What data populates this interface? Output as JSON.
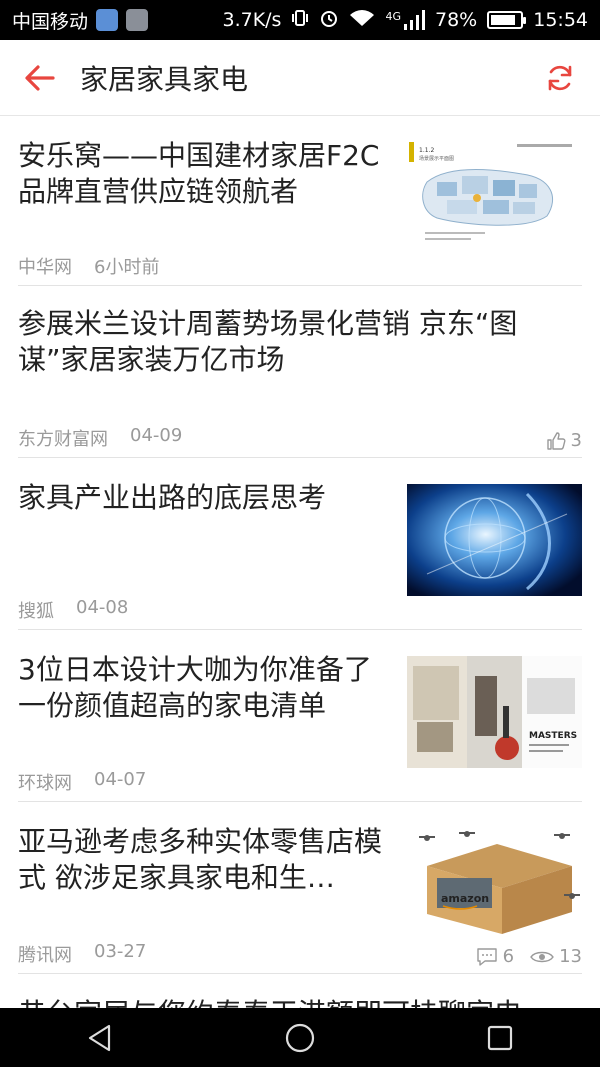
{
  "status_bar": {
    "carrier": "中国移动",
    "net_speed": "3.7K/s",
    "network_type": "4G",
    "battery": "78%",
    "battery_level": 0.78,
    "time": "15:54"
  },
  "app_bar": {
    "title": "家居家具家电"
  },
  "colors": {
    "accent": "#e8463f"
  },
  "articles": [
    {
      "headline": "安乐窝——中国建材家居F2C品牌直营供应链领航者",
      "source": "中华网",
      "time": "6小时前",
      "image": "floor-plan"
    },
    {
      "headline": "参展米兰设计周蓄势场景化营销 京东“图谋”家居家装万亿市场",
      "source": "东方财富网",
      "time": "04-09",
      "likes": "3"
    },
    {
      "headline": "家具产业出路的底层思考",
      "source": "搜狐",
      "time": "04-08",
      "image": "globe"
    },
    {
      "headline": "3位日本设计大咖为你准备了一份颜值超高的家电清单",
      "source": "环球网",
      "time": "04-07",
      "image": "interior"
    },
    {
      "headline": "亚马逊考虑多种实体零售店模式 欲涉足家具家电和生…",
      "source": "腾讯网",
      "time": "03-27",
      "comments": "6",
      "views": "13",
      "image": "amazon-box"
    },
    {
      "headline": "昔台家居与您约春春王港额即可挂聊家电"
    }
  ]
}
